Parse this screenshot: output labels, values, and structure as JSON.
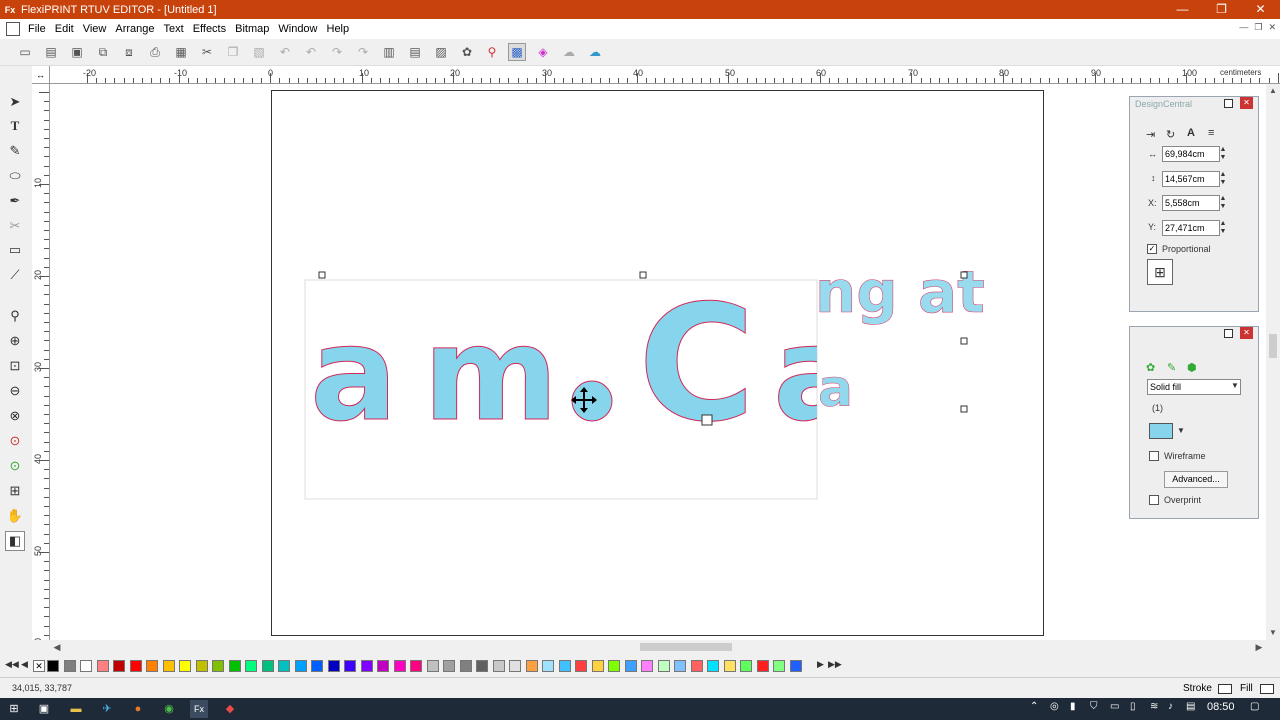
{
  "window": {
    "app_icon": "Fx",
    "title": "FlexiPRINT RTUV EDITOR - [Untitled 1]",
    "controls": [
      "—",
      "❐",
      "✕"
    ]
  },
  "menu": {
    "items": [
      "File",
      "Edit",
      "View",
      "Arrange",
      "Text",
      "Effects",
      "Bitmap",
      "Window",
      "Help"
    ],
    "mdi_controls": [
      "—",
      "❐",
      "✕"
    ]
  },
  "toolbar": {
    "icons": [
      "new-icon",
      "open-icon",
      "save-icon",
      "import-icon",
      "export-icon",
      "print-icon",
      "plot-icon",
      "cut-icon",
      "copy-icon",
      "paste-icon",
      "undo-icon",
      "undo2-icon",
      "redo-icon",
      "redo2-icon",
      "group-icon",
      "ungroup-icon",
      "arrange-icon",
      "color-icon",
      "pen-icon",
      "palette-icon",
      "spectrum-icon",
      "cloud-icon",
      "upload-icon"
    ]
  },
  "ruler": {
    "unit": "centimeters",
    "h_labels": [
      "-20",
      "-10",
      "0",
      "10",
      "20",
      "30",
      "40",
      "50",
      "60",
      "70",
      "80",
      "90",
      "100"
    ],
    "v_labels": [
      "10",
      "20",
      "30",
      "40",
      "50",
      "60"
    ],
    "corner": "↔"
  },
  "canvas": {
    "row1_text": "ng at",
    "row2_letters": [
      "a",
      "m",
      ".",
      "C",
      "a"
    ],
    "extra_text": "a",
    "fill_color": "#87d5ec",
    "stroke_color": "#d0285a"
  },
  "design_central": {
    "title": "DesignCentral",
    "width": "69,984cm",
    "height": "14,567cm",
    "x_label": "X:",
    "x": "5,558cm",
    "y_label": "Y:",
    "y": "27,471cm",
    "proportional_label": "Proportional",
    "proportional_checked": "✓"
  },
  "fill_panel": {
    "fill_type": "Solid fill",
    "index": "(1)",
    "color": "#87d5ec",
    "wireframe_label": "Wireframe",
    "advanced_label": "Advanced...",
    "overprint_label": "Overprint"
  },
  "status": {
    "coordinates": "34,015, 33,787",
    "stroke_label": "Stroke",
    "fill_label": "Fill"
  },
  "taskbar": {
    "time": "08:50"
  },
  "palette_colors": [
    "#000000",
    "#7f7f7f",
    "#ffffff",
    "#ff8080",
    "#c00000",
    "#ff0000",
    "#ff8000",
    "#ffc000",
    "#ffff00",
    "#c0c000",
    "#80c000",
    "#00c000",
    "#00ff80",
    "#00c080",
    "#00c0c0",
    "#00a0ff",
    "#0060ff",
    "#0000c0",
    "#4000ff",
    "#8000ff",
    "#c000c0",
    "#ff00c0",
    "#ff0080",
    "#c0c0c0",
    "#a0a0a0",
    "#808080",
    "#606060",
    "#c8c8c8",
    "#e0e0e0",
    "#ffa040",
    "#a0e0ff",
    "#40c0ff",
    "#ff4040",
    "#ffd040",
    "#80ff00",
    "#40a0ff",
    "#ff80ff",
    "#c0ffc0",
    "#80c0ff",
    "#ff6060",
    "#00e0ff",
    "#ffe060",
    "#60ff60",
    "#ff2020",
    "#80ff80",
    "#2060ff"
  ]
}
